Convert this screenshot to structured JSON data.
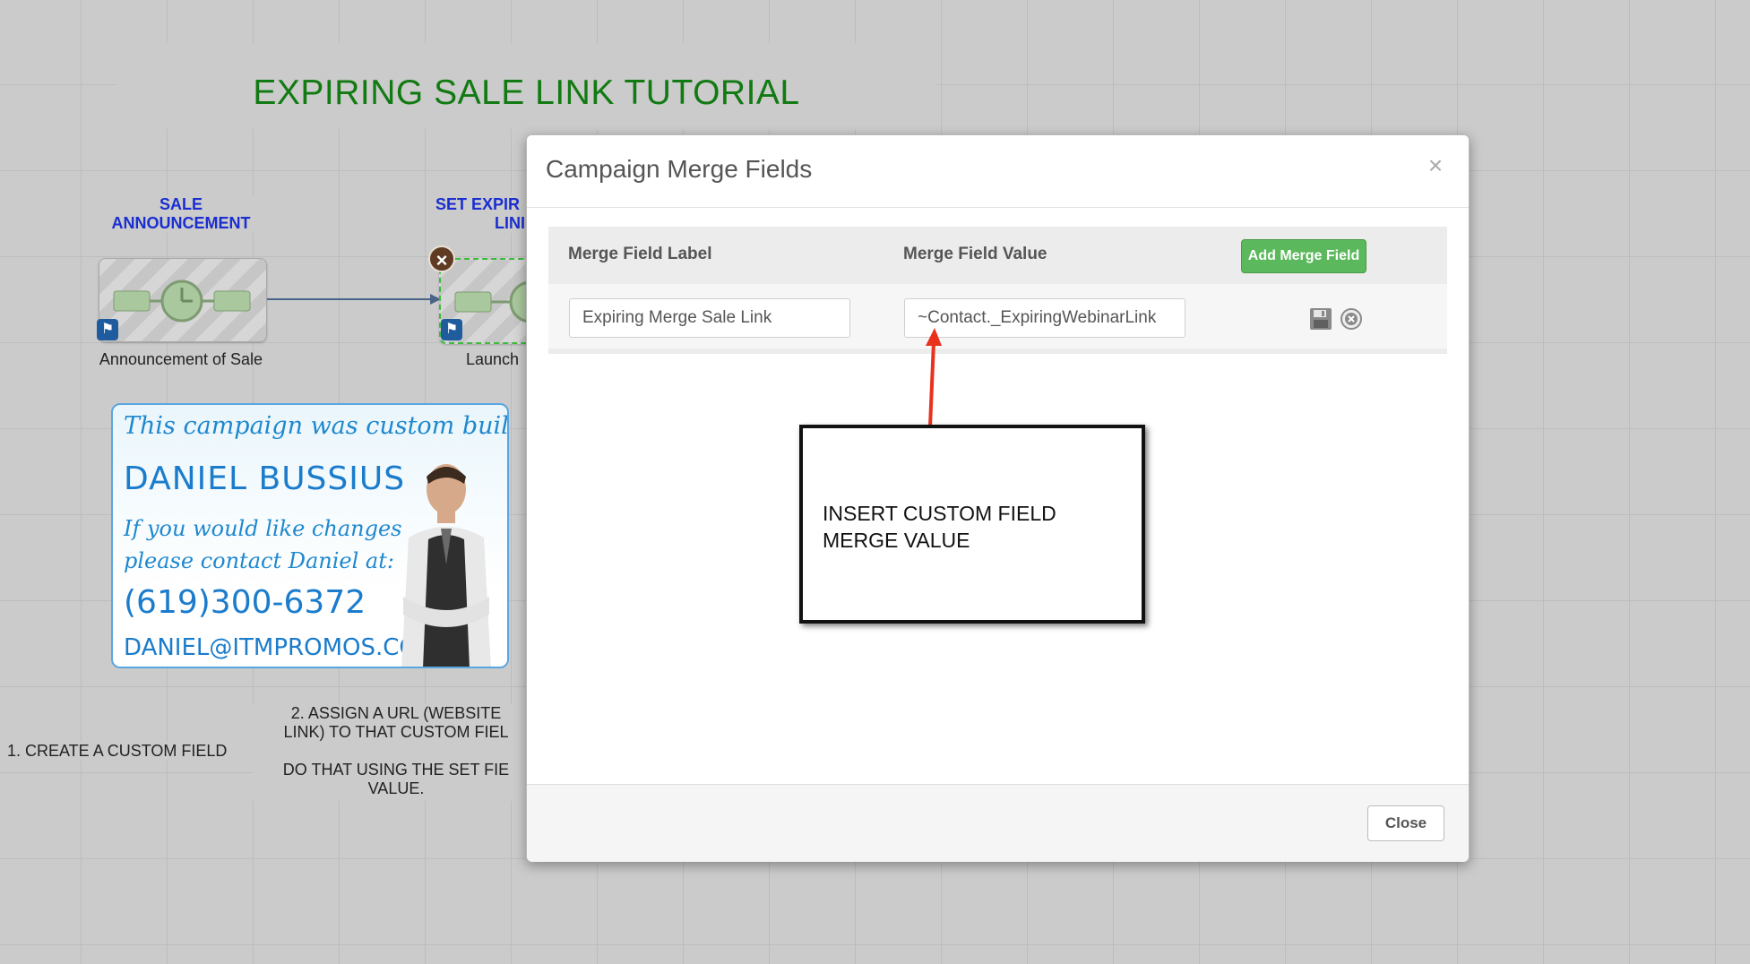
{
  "canvas": {
    "title": "EXPIRING SALE LINK TUTORIAL",
    "sequences": [
      {
        "label": "SALE ANNOUNCEMENT",
        "caption": "Announcement of Sale"
      },
      {
        "label": "SET EXPIR LINI",
        "caption": "Launch"
      }
    ],
    "notes": {
      "step1": "1. CREATE A CUSTOM FIELD",
      "step2_line1": "2. ASSIGN A URL (WEBSITE",
      "step2_line2": "LINK) TO THAT CUSTOM FIEL",
      "step2_line3": "DO THAT USING THE SET FIE",
      "step2_line4": "VALUE."
    },
    "card": {
      "line1": "This campaign was custom built by:",
      "name": "DANIEL BUSSIUS",
      "line2": "If you would like changes",
      "line3": "please contact Daniel at:",
      "phone": "(619)300-6372",
      "email": "DANIEL@ITMPROMOS.COM"
    }
  },
  "modal": {
    "title": "Campaign Merge Fields",
    "close_x": "×",
    "columns": {
      "label": "Merge Field Label",
      "value": "Merge Field Value"
    },
    "add_button": "Add Merge Field",
    "rows": [
      {
        "label": "Expiring Merge Sale Link",
        "value": "~Contact._ExpiringWebinarLink"
      }
    ],
    "close_button": "Close"
  },
  "annotation": {
    "text_line1": "INSERT CUSTOM FIELD",
    "text_line2": "MERGE VALUE",
    "arrow_color": "#e8321e"
  },
  "colors": {
    "title_green": "#127a12",
    "sequence_blue": "#1a2ed0",
    "button_green": "#5cb85c"
  }
}
